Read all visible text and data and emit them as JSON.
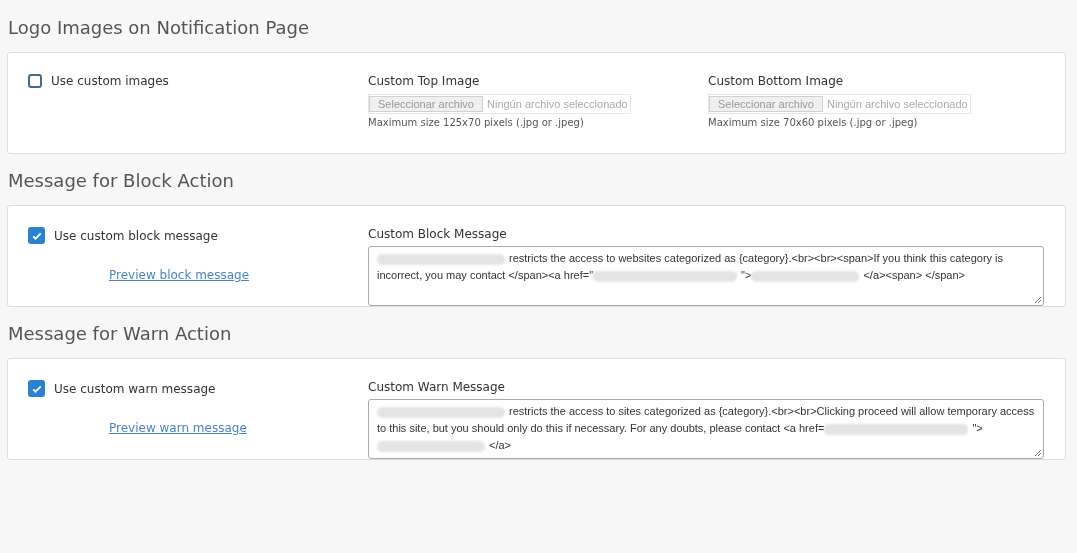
{
  "sections": [
    {
      "kind": "images",
      "title": "Logo Images on Notification Page",
      "checkbox": {
        "label": "Use custom images",
        "checked": false
      },
      "images": [
        {
          "label": "Custom Top Image",
          "button": "Seleccionar archivo",
          "status": "Ningún archivo seleccionado",
          "hint": "Maximum size 125x70 pixels (.jpg or .jpeg)"
        },
        {
          "label": "Custom Bottom Image",
          "button": "Seleccionar archivo",
          "status": "Ningún archivo seleccionado",
          "hint": "Maximum size 70x60 pixels (.jpg or .jpeg)"
        }
      ]
    },
    {
      "kind": "message",
      "title": "Message for Block Action",
      "checkbox": {
        "label": "Use custom block message",
        "checked": true
      },
      "preview_link": "Preview block message",
      "message_label": "Custom Block Message",
      "message": [
        {
          "kind": "redacted"
        },
        {
          "kind": "text",
          "text": "restricts the access to websites categorized as {category}.<br><br><span>If you think this category is incorrect, you may contact </span><a href=\""
        },
        {
          "kind": "redacted"
        },
        {
          "kind": "text",
          "text": "\">"
        },
        {
          "kind": "redacted"
        },
        {
          "kind": "text",
          "text": "</a><span> </span>"
        }
      ]
    },
    {
      "kind": "message",
      "title": "Message for Warn Action",
      "checkbox": {
        "label": "Use custom warn message",
        "checked": true
      },
      "preview_link": "Preview warn message",
      "message_label": "Custom Warn Message",
      "message": [
        {
          "kind": "redacted"
        },
        {
          "kind": "text",
          "text": "restricts the access to sites categorized as {category}.<br><br>Clicking proceed will allow temporary access to this site, but you should only do this if necessary. For any doubts, please contact <a href="
        },
        {
          "kind": "redacted"
        },
        {
          "kind": "text",
          "text": "\">"
        },
        {
          "kind": "redacted"
        },
        {
          "kind": "text",
          "text": "</a>"
        }
      ]
    }
  ]
}
